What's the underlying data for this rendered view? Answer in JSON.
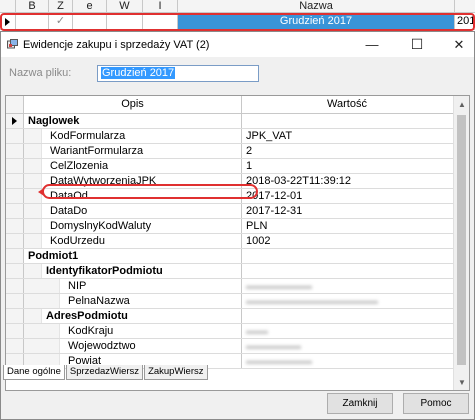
{
  "background_grid": {
    "columns": [
      "B",
      "Z",
      "e",
      "W",
      "I",
      "Nazwa",
      ""
    ],
    "row": {
      "checkmark": "✓",
      "name": "Grudzień 2017",
      "extra": "201"
    }
  },
  "dialog": {
    "title": "Ewidencje zakupu i sprzedaży VAT (2)",
    "minimize": "—",
    "maximize": "☐",
    "close": "✕",
    "file_label": "Nazwa pliku:",
    "file_value": "Grudzień 2017"
  },
  "grid": {
    "headers": {
      "opis": "Opis",
      "wartosc": "Wartość"
    },
    "rows": [
      {
        "label": "Naglowek",
        "value": ""
      },
      {
        "label": "KodFormularza",
        "value": "JPK_VAT"
      },
      {
        "label": "WariantFormularza",
        "value": "2"
      },
      {
        "label": "CelZlozenia",
        "value": "1"
      },
      {
        "label": "DataWytworzeniaJPK",
        "value": "2018-03-22T11:39:12"
      },
      {
        "label": "DataOd",
        "value": "2017-12-01"
      },
      {
        "label": "DataDo",
        "value": "2017-12-31"
      },
      {
        "label": "DomyslnyKodWaluty",
        "value": "PLN"
      },
      {
        "label": "KodUrzedu",
        "value": "1002"
      },
      {
        "label": "Podmiot1",
        "value": ""
      },
      {
        "label": "IdentyfikatorPodmiotu",
        "value": ""
      },
      {
        "label": "NIP",
        "value": ""
      },
      {
        "label": "PelnaNazwa",
        "value": ""
      },
      {
        "label": "AdresPodmiotu",
        "value": ""
      },
      {
        "label": "KodKraju",
        "value": ""
      },
      {
        "label": "Wojewodztwo",
        "value": ""
      },
      {
        "label": "Powiat",
        "value": ""
      }
    ]
  },
  "tabs": [
    "Dane ogólne",
    "SprzedazWiersz",
    "ZakupWiersz"
  ],
  "buttons": {
    "close": "Zamknij",
    "help": "Pomoc"
  },
  "colors": {
    "selection": "#3a94d8",
    "highlight": "#e03030"
  },
  "icons": {
    "row_selector": "triangle-right-icon",
    "app": "window-app-icon"
  }
}
